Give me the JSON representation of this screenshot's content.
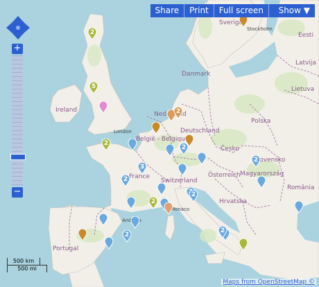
{
  "toolbar": {
    "share_label": "Share",
    "print_label": "Print",
    "fullscreen_label": "Full screen",
    "show_label": "Show ▼"
  },
  "zoom": {
    "plus_label": "+",
    "minus_label": "−"
  },
  "scale": {
    "km_label": "500 km",
    "mi_label": "500 mi"
  },
  "attribution": "Maps from OpenStreetMap ©",
  "labels": {
    "ireland": "Ireland",
    "danmark": "Danmark",
    "sverige": "Sverige",
    "eesti": "Eesti",
    "latvija": "Latvija",
    "lietuva": "Lietuva",
    "nederland": "Nederland",
    "belgique": "België - Belgique",
    "deutschland": "Deutschland",
    "polska": "Polska",
    "cesko": "Česko",
    "slovensko": "Slovensko",
    "osterreich": "Österreich",
    "switzerland": "Switzerland",
    "france": "France",
    "magyarorszag": "Magyarország",
    "romania": "România",
    "hrvatska": "Hrvatska",
    "portugal": "Portugal",
    "london": "London",
    "stockholm": "Stockholm",
    "monaco": "Monaco",
    "andorra": "Andorra"
  },
  "markers": [
    {
      "label": "2",
      "color": "#a9b83a"
    },
    {
      "label": "",
      "color": "#c98a2b"
    },
    {
      "label": "5",
      "color": "#a9b83a"
    },
    {
      "label": "",
      "color": "#e48ad0"
    },
    {
      "label": "",
      "color": "#d99a5a"
    },
    {
      "label": "2",
      "color": "#d99a5a"
    },
    {
      "label": "",
      "color": "#c98a2b"
    },
    {
      "label": "2",
      "color": "#a9b83a"
    },
    {
      "label": "",
      "color": "#6aa9e0"
    },
    {
      "label": "",
      "color": "#c98a2b"
    },
    {
      "label": "2",
      "color": "#6aa9e0"
    },
    {
      "label": "",
      "color": "#6aa9e0"
    },
    {
      "label": "",
      "color": "#6aa9e0"
    },
    {
      "label": "3",
      "color": "#6aa9e0"
    },
    {
      "label": "",
      "color": "#6aa9e0"
    },
    {
      "label": "2",
      "color": "#6aa9e0"
    },
    {
      "label": "2",
      "color": "#6aa9e0"
    },
    {
      "label": "",
      "color": "#6aa9e0"
    },
    {
      "label": "2",
      "color": "#6aa9e0"
    },
    {
      "label": "",
      "color": "#6aa9e0"
    },
    {
      "label": "2",
      "color": "#a9b83a"
    },
    {
      "label": "",
      "color": "#6aa9e0"
    },
    {
      "label": "2",
      "color": "#6aa9e0"
    },
    {
      "label": "",
      "color": "#e0a070"
    },
    {
      "label": "",
      "color": "#6aa9e0"
    },
    {
      "label": "",
      "color": "#6aa9e0"
    },
    {
      "label": "",
      "color": "#c98a2b"
    },
    {
      "label": "",
      "color": "#6aa9e0"
    },
    {
      "label": "",
      "color": "#6aa9e0"
    },
    {
      "label": "2",
      "color": "#6aa9e0"
    },
    {
      "label": "",
      "color": "#6aa9e0"
    },
    {
      "label": "2",
      "color": "#6aa9e0"
    },
    {
      "label": "",
      "color": "#a9b83a"
    },
    {
      "label": "",
      "color": "#6aa9e0"
    }
  ],
  "colors": {
    "sea": "#aad3df",
    "land": "#f2efe9",
    "forest": "#d6e8c2",
    "border": "#a77aa6",
    "control": "#2c5fd0"
  }
}
